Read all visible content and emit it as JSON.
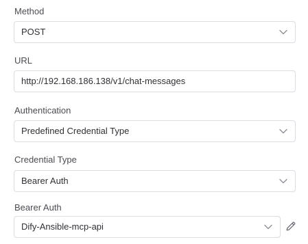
{
  "fields": [
    {
      "label": "Method",
      "value": "POST",
      "type": "select"
    },
    {
      "label": "URL",
      "value": "http://192.168.186.138/v1/chat-messages",
      "type": "input"
    },
    {
      "label": "Authentication",
      "value": "Predefined Credential Type",
      "type": "select"
    },
    {
      "label": "Credential Type",
      "value": "Bearer Auth",
      "type": "select"
    },
    {
      "label": "Bearer Auth",
      "value": "Dify-Ansible-mcp-api",
      "type": "select"
    }
  ],
  "icons": {
    "dropdown": "chevron-down-icon",
    "edit": "pencil-icon"
  },
  "colors": {
    "border": "#dcdce3",
    "label": "#4b4b52",
    "text": "#303035",
    "icon": "#6b6b74"
  }
}
